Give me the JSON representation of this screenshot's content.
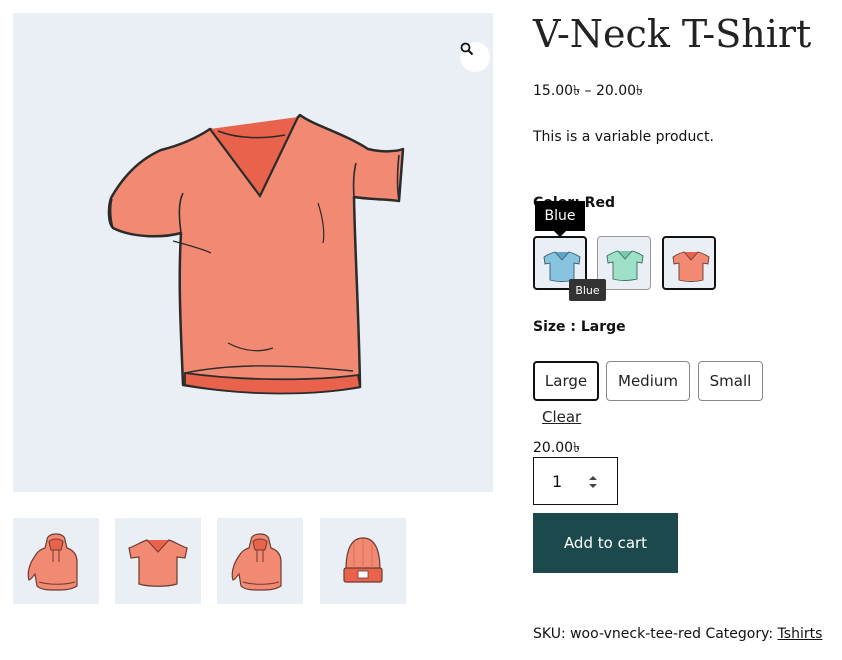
{
  "product": {
    "title": "V-Neck T-Shirt",
    "price_range": "15.00৳  – 20.00৳",
    "description": "This is a variable product."
  },
  "gallery": {
    "main_image": "v-neck-tshirt-red-image",
    "zoom_icon": "magnifier-icon",
    "thumbnails": [
      "hoodie-image",
      "v-neck-tshirt-image",
      "hoodie-image",
      "beanie-image"
    ]
  },
  "color": {
    "label": "Color: Red",
    "tooltip": "Blue",
    "tooltip_small": "Blue",
    "swatches": [
      {
        "name": "Blue",
        "color": "#86c4e0"
      },
      {
        "name": "Green",
        "color": "#9fe0c8"
      },
      {
        "name": "Red",
        "color": "#f28a73"
      }
    ]
  },
  "size": {
    "label": "Size : Large",
    "options": [
      "Large",
      "Medium",
      "Small"
    ],
    "selected": "Large"
  },
  "clear_label": "Clear",
  "variation_price": "20.00৳",
  "quantity": "1",
  "add_to_cart": "Add to cart",
  "meta": {
    "sku_label": "SKU:",
    "sku": "woo-vneck-tee-red",
    "category_label": "Category:",
    "category": "Tshirts"
  },
  "colors": {
    "accent": "#1c4a4c",
    "image_bg": "#e9eff4",
    "shirt": "#f28a73"
  }
}
